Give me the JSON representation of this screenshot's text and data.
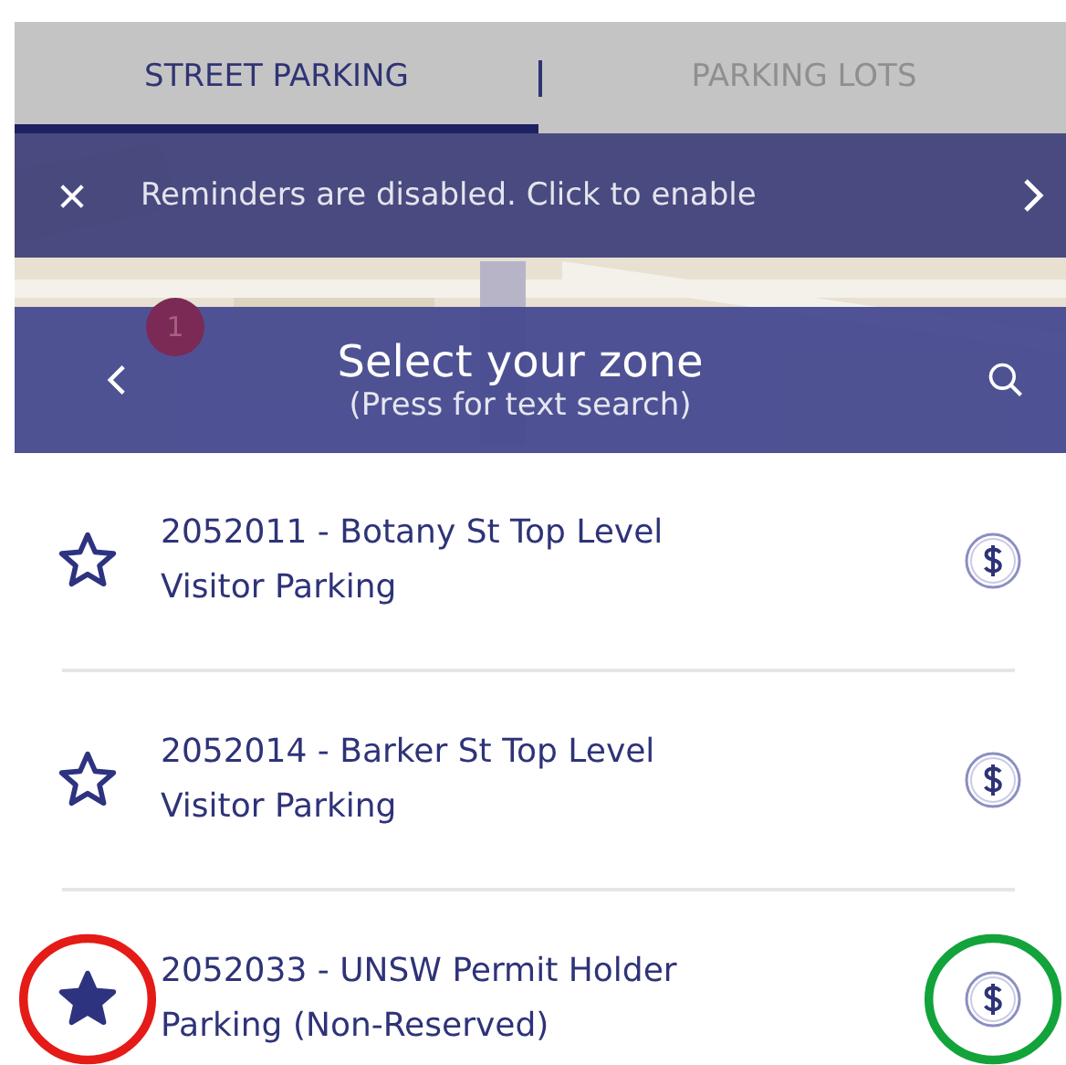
{
  "tabs": [
    {
      "label": "STREET PARKING",
      "selected": true
    },
    {
      "label": "PARKING LOTS",
      "selected": false
    }
  ],
  "banner": {
    "text": "Reminders are disabled. Click to enable"
  },
  "map": {
    "kind": "picture",
    "badge": "1"
  },
  "header": {
    "title": "Select your zone",
    "subtitle": "(Press for text search)"
  },
  "zones": [
    {
      "name": "2052011 - Botany St Top Level Visitor Parking",
      "favorite": false,
      "annotated": false
    },
    {
      "name": "2052014 - Barker St Top Level Visitor Parking",
      "favorite": false,
      "annotated": false
    },
    {
      "name": "2052033 - UNSW Permit Holder Parking (Non-Reserved)",
      "favorite": true,
      "annotated": true
    }
  ]
}
